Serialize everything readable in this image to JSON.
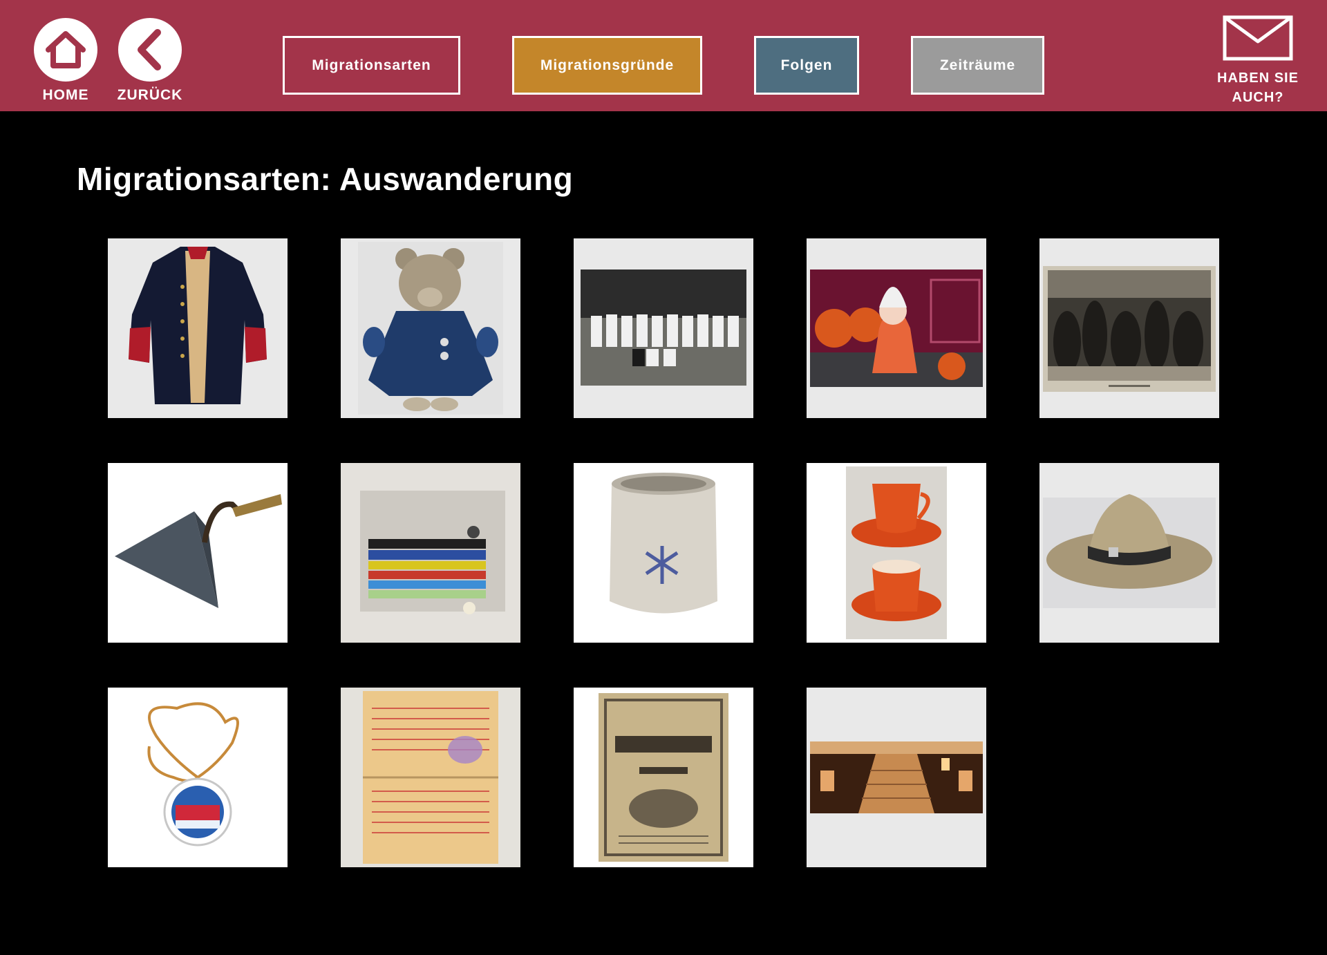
{
  "header": {
    "home_label": "HOME",
    "back_label": "ZURÜCK",
    "categories": [
      {
        "label": "Migrationsarten",
        "fill": "#a3344a"
      },
      {
        "label": "Migrationsgründe",
        "fill": "#c4862a"
      },
      {
        "label": "Folgen",
        "fill": "#4e6e80"
      },
      {
        "label": "Zeiträume",
        "fill": "#9b9b9b"
      }
    ],
    "mail_label_line1": "HABEN SIE",
    "mail_label_line2": "AUCH?",
    "bar_color": "#a3344a"
  },
  "main": {
    "title": "Migrationsarten: Auswanderung"
  },
  "objects": [
    {
      "icon": "coat-icon"
    },
    {
      "icon": "teddy-bear-icon"
    },
    {
      "icon": "team-photo-icon"
    },
    {
      "icon": "child-pumpkins-photo-icon"
    },
    {
      "icon": "engraving-crowd-icon"
    },
    {
      "icon": "trowel-icon"
    },
    {
      "icon": "sewing-kit-icon"
    },
    {
      "icon": "mug-icon"
    },
    {
      "icon": "cups-saucers-icon"
    },
    {
      "icon": "scout-hat-icon"
    },
    {
      "icon": "medal-necklace-icon"
    },
    {
      "icon": "identification-card-icon"
    },
    {
      "icon": "calendar-booklet-icon"
    },
    {
      "icon": "staircase-hall-icon"
    }
  ]
}
